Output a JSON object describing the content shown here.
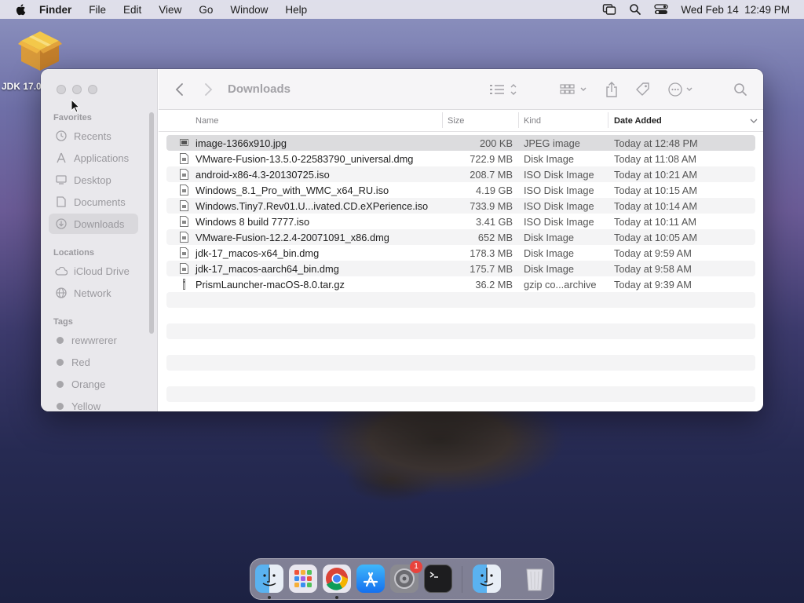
{
  "menubar": {
    "app_name": "Finder",
    "menus": [
      "File",
      "Edit",
      "View",
      "Go",
      "Window",
      "Help"
    ],
    "datetime": "Wed Feb 14  12:49 PM",
    "status_icons": [
      "screen-mirroring-icon",
      "spotlight-search-icon",
      "control-center-icon"
    ]
  },
  "desktop": {
    "icon_label": "JDK 17.0"
  },
  "window": {
    "title": "Downloads",
    "sidebar": {
      "favorites_heading": "Favorites",
      "favorites": [
        {
          "label": "Recents",
          "icon": "clock-icon"
        },
        {
          "label": "Applications",
          "icon": "applications-icon"
        },
        {
          "label": "Desktop",
          "icon": "desktop-icon"
        },
        {
          "label": "Documents",
          "icon": "document-icon"
        },
        {
          "label": "Downloads",
          "icon": "download-icon",
          "selected": true
        }
      ],
      "locations_heading": "Locations",
      "locations": [
        {
          "label": "iCloud Drive",
          "icon": "cloud-icon"
        },
        {
          "label": "Network",
          "icon": "globe-icon"
        }
      ],
      "tags_heading": "Tags",
      "tags": [
        "rewwrerer",
        "Red",
        "Orange",
        "Yellow"
      ]
    },
    "columns": {
      "name": "Name",
      "size": "Size",
      "kind": "Kind",
      "date": "Date Added"
    },
    "files": [
      {
        "name": "image-1366x910.jpg",
        "size": "200 KB",
        "kind": "JPEG image",
        "date": "Today at 12:48 PM",
        "selected": true
      },
      {
        "name": "VMware-Fusion-13.5.0-22583790_universal.dmg",
        "size": "722.9 MB",
        "kind": "Disk Image",
        "date": "Today at 11:08 AM"
      },
      {
        "name": "android-x86-4.3-20130725.iso",
        "size": "208.7 MB",
        "kind": "ISO Disk Image",
        "date": "Today at 10:21 AM"
      },
      {
        "name": "Windows_8.1_Pro_with_WMC_x64_RU.iso",
        "size": "4.19 GB",
        "kind": "ISO Disk Image",
        "date": "Today at 10:15 AM"
      },
      {
        "name": "Windows.Tiny7.Rev01.U...ivated.CD.eXPerience.iso",
        "size": "733.9 MB",
        "kind": "ISO Disk Image",
        "date": "Today at 10:14 AM"
      },
      {
        "name": "Windows 8 build 7777.iso",
        "size": "3.41 GB",
        "kind": "ISO Disk Image",
        "date": "Today at 10:11 AM"
      },
      {
        "name": "VMware-Fusion-12.2.4-20071091_x86.dmg",
        "size": "652 MB",
        "kind": "Disk Image",
        "date": "Today at 10:05 AM"
      },
      {
        "name": "jdk-17_macos-x64_bin.dmg",
        "size": "178.3 MB",
        "kind": "Disk Image",
        "date": "Today at 9:59 AM"
      },
      {
        "name": "jdk-17_macos-aarch64_bin.dmg",
        "size": "175.7 MB",
        "kind": "Disk Image",
        "date": "Today at 9:58 AM"
      },
      {
        "name": "PrismLauncher-macOS-8.0.tar.gz",
        "size": "36.2 MB",
        "kind": "gzip co...archive",
        "date": "Today at 9:39 AM"
      }
    ]
  },
  "dock": {
    "apps": [
      "finder-icon",
      "launchpad-icon",
      "chrome-icon",
      "app-store-icon",
      "system-settings-icon",
      "terminal-icon",
      "finder-icon",
      "trash-icon"
    ],
    "settings_badge": "1"
  }
}
